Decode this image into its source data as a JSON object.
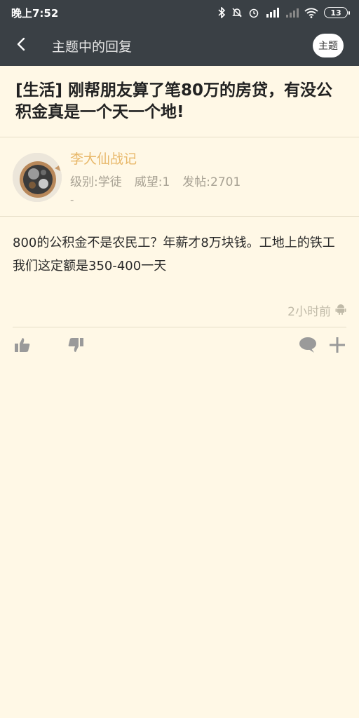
{
  "status": {
    "time": "晚上7:52",
    "battery": "13"
  },
  "appbar": {
    "title": "主题中的回复",
    "topic_button": "主题"
  },
  "post": {
    "title": "[生活] 刚帮朋友算了笔80万的房贷，有没公积金真是一个天一个地!",
    "body": "800的公积金不是农民工？年薪才8万块钱。工地上的铁工我们这定额是350-400一天",
    "time": "2小时前"
  },
  "author": {
    "name": "李大仙战记",
    "level": "级别:学徒",
    "prestige": "威望:1",
    "posts": "发帖:2701",
    "signature": "-"
  },
  "colors": {
    "background": "#fff8e6",
    "appbar": "#3a4045",
    "author_name": "#e8b86a",
    "meta_text": "#a8a294"
  },
  "icons": {
    "back": "chevron-left-icon",
    "like": "thumbs-up-icon",
    "dislike": "thumbs-down-icon",
    "comment": "comment-icon",
    "add": "plus-icon",
    "platform": "android-icon"
  }
}
